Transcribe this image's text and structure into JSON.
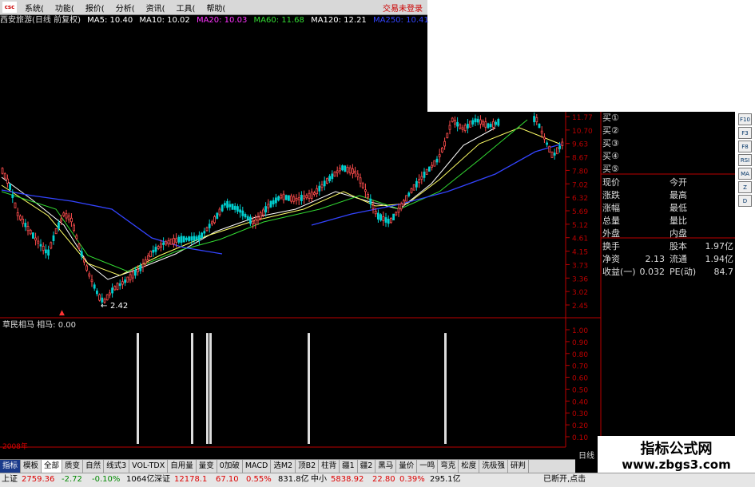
{
  "menubar": {
    "logo": "csc",
    "items": [
      "系统(",
      "功能(",
      "报价(",
      "分析(",
      "资讯(",
      "工具(",
      "帮助("
    ],
    "trade_status": "交易未登录"
  },
  "infoline": {
    "stock": "西安旅游(日线 前复权)",
    "ma": [
      {
        "label": "MA5: 10.40",
        "color": "#ffffff"
      },
      {
        "label": "MA10: 10.02",
        "color": "#ffffff"
      },
      {
        "label": "MA20: 10.03",
        "color": "#ff33ff"
      },
      {
        "label": "MA60: 11.68",
        "color": "#33dd33"
      },
      {
        "label": "MA120: 12.21",
        "color": "#ffffff"
      },
      {
        "label": "MA250: 10.41",
        "color": "#3344ff"
      }
    ]
  },
  "price_axis": [
    "11.77",
    "10.70",
    "9.63",
    "8.67",
    "7.80",
    "7.02",
    "6.32",
    "5.69",
    "5.12",
    "4.61",
    "4.15",
    "3.73",
    "3.36",
    "3.02",
    "2.45"
  ],
  "indicator_axis": [
    "1.00",
    "0.90",
    "0.80",
    "0.70",
    "0.60",
    "0.50",
    "0.40",
    "0.30",
    "0.20",
    "0.10"
  ],
  "low_label": "2.42",
  "indicator_title": "草民相马  相马: 0.00",
  "chart_data": {
    "type": "bar",
    "title": "草民相马",
    "signal_positions": [
      172,
      240,
      259,
      263,
      386,
      557
    ],
    "signal_values": [
      1,
      1,
      1,
      1,
      1,
      1
    ],
    "ylim": [
      0,
      1.05
    ]
  },
  "quote_panel": {
    "buy": [
      "买①",
      "买②",
      "买③",
      "买④",
      "买⑤"
    ],
    "rows": [
      {
        "l1": "现价",
        "l2": "今开"
      },
      {
        "l1": "涨跌",
        "l2": "最高"
      },
      {
        "l1": "涨幅",
        "l2": "最低"
      },
      {
        "l1": "总量",
        "l2": "量比"
      },
      {
        "l1": "外盘",
        "l2": "内盘"
      }
    ],
    "stats": [
      {
        "l1": "换手",
        "v1": "",
        "l2": "股本",
        "v2": "1.97亿"
      },
      {
        "l1": "净资",
        "v1": "2.13",
        "l2": "流通",
        "v2": "1.94亿"
      },
      {
        "l1": "收益(一)",
        "v1": "0.032",
        "l2": "PE(动)",
        "v2": "84.7"
      }
    ]
  },
  "toolbar": [
    "F10",
    "F3",
    "F8",
    "RSI",
    "MA",
    "Z",
    "D"
  ],
  "tabs": [
    "指标",
    "模板",
    "全部",
    "质变",
    "自然",
    "线式3",
    "VOL-TDX",
    "自用量",
    "量变",
    "0加破",
    "MACD",
    "选M2",
    "顶B2",
    "柱背",
    "疆1",
    "疆2",
    "黑马",
    "量价",
    "一鸣",
    "弯克",
    "松度",
    "洗极强",
    "研判"
  ],
  "period": "日线",
  "date_axis": "2008年",
  "bottom": {
    "sh_label": "上证",
    "sh_val": "2759.36",
    "sh_chg": "-2.72",
    "sh_pct": "-0.10%",
    "sh_amt": "1064亿",
    "sz_label": "深证",
    "sz_val": "12178.1",
    "sz_chg": "67.10",
    "sz_pct": "0.55%",
    "sz_amt": "831.8亿",
    "zx_label": "中小",
    "zx_val": "5838.92",
    "zx_chg": "22.80",
    "zx_pct": "0.39%",
    "zx_amt": "295.1亿",
    "status": "已断开,点击"
  },
  "watermark": {
    "line1": "指标公式网",
    "line2": "www.zbgs3.com"
  }
}
